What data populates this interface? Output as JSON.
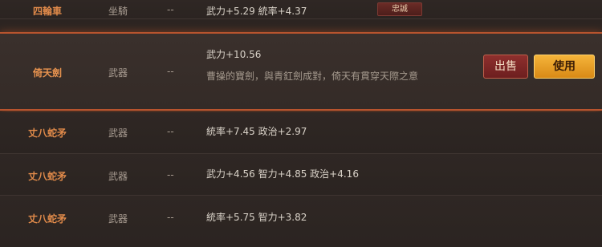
{
  "items": [
    {
      "name": "四輪車",
      "type": "坐騎",
      "dash": "--",
      "stats": "武力+5.29  統率+4.37",
      "tag": "忠誠"
    },
    {
      "name": "倚天劍",
      "type": "武器",
      "dash": "--",
      "stats": "武力+10.56",
      "desc": "曹操的寶劍，與青釭劍成對，倚天有貫穿天際之意",
      "selected": true
    },
    {
      "name": "丈八蛇矛",
      "type": "武器",
      "dash": "--",
      "stats": "統率+7.45  政治+2.97"
    },
    {
      "name": "丈八蛇矛",
      "type": "武器",
      "dash": "--",
      "stats": "武力+4.56  智力+4.85  政治+4.16"
    },
    {
      "name": "丈八蛇矛",
      "type": "武器",
      "dash": "--",
      "stats": "統率+5.75  智力+3.82"
    }
  ],
  "actions": {
    "sell_label": "出售",
    "use_label": "使用"
  },
  "colors": {
    "name": "#e08a4a",
    "highlight_border": "#b8542e",
    "sell_button": "#8e2f2d",
    "use_button": "#f4b43a"
  }
}
